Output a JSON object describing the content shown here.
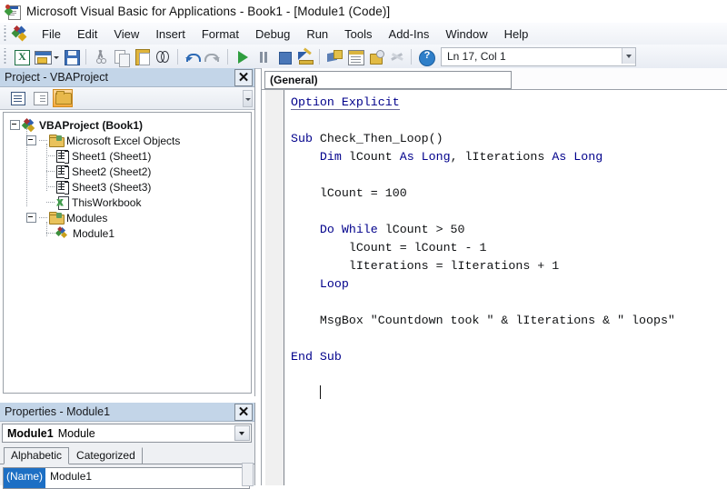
{
  "window": {
    "title": "Microsoft Visual Basic for Applications - Book1 - [Module1 (Code)]",
    "app_icon": "vba-document-icon"
  },
  "menubar": {
    "logo_icon": "vba-logo-icon",
    "items": [
      {
        "label": "File",
        "accel": "F"
      },
      {
        "label": "Edit",
        "accel": "E"
      },
      {
        "label": "View",
        "accel": "V"
      },
      {
        "label": "Insert",
        "accel": "I"
      },
      {
        "label": "Format",
        "accel": "o"
      },
      {
        "label": "Debug",
        "accel": "D"
      },
      {
        "label": "Run",
        "accel": "R"
      },
      {
        "label": "Tools",
        "accel": "T"
      },
      {
        "label": "Add-Ins",
        "accel": "A"
      },
      {
        "label": "Window",
        "accel": "W"
      },
      {
        "label": "Help",
        "accel": "H"
      }
    ]
  },
  "toolbar": {
    "buttons": [
      {
        "name": "view-excel-button",
        "icon": "excel-icon",
        "tooltip": "View Microsoft Excel"
      },
      {
        "name": "insert-userform-button",
        "icon": "insert-object-icon",
        "tooltip": "Insert"
      },
      {
        "name": "save-button",
        "icon": "save-icon",
        "tooltip": "Save Book1"
      },
      {
        "name": "cut-button",
        "icon": "scissors-icon",
        "tooltip": "Cut"
      },
      {
        "name": "copy-button",
        "icon": "copy-icon",
        "tooltip": "Copy"
      },
      {
        "name": "paste-button",
        "icon": "clipboard-icon",
        "tooltip": "Paste"
      },
      {
        "name": "find-button",
        "icon": "binoculars-icon",
        "tooltip": "Find"
      },
      {
        "name": "undo-button",
        "icon": "undo-arrow-icon",
        "tooltip": "Undo"
      },
      {
        "name": "redo-button",
        "icon": "redo-arrow-icon",
        "tooltip": "Redo"
      },
      {
        "name": "run-button",
        "icon": "play-triangle-icon",
        "tooltip": "Run Sub/UserForm"
      },
      {
        "name": "break-button",
        "icon": "pause-bars-icon",
        "tooltip": "Break"
      },
      {
        "name": "reset-button",
        "icon": "stop-square-icon",
        "tooltip": "Reset"
      },
      {
        "name": "design-mode-button",
        "icon": "design-mode-icon",
        "tooltip": "Design Mode"
      },
      {
        "name": "project-explorer-button",
        "icon": "project-explorer-icon",
        "tooltip": "Project Explorer"
      },
      {
        "name": "properties-window-button",
        "icon": "properties-window-icon",
        "tooltip": "Properties Window"
      },
      {
        "name": "object-browser-button",
        "icon": "object-browser-icon",
        "tooltip": "Object Browser"
      },
      {
        "name": "toolbox-button",
        "icon": "toolbox-wrench-icon",
        "tooltip": "Toolbox"
      },
      {
        "name": "help-button",
        "icon": "help-question-icon",
        "tooltip": "Microsoft Visual Basic for Applications Help"
      }
    ],
    "position_indicator": "Ln 17, Col 1"
  },
  "project_explorer": {
    "title": "Project - VBAProject",
    "close_label": "✕",
    "toolbar": [
      {
        "name": "view-code-button",
        "icon": "view-code-icon",
        "active": false
      },
      {
        "name": "view-object-button",
        "icon": "view-object-icon",
        "active": false
      },
      {
        "name": "toggle-folders-button",
        "icon": "folder-icon",
        "active": true
      }
    ],
    "tree": [
      {
        "label": "VBAProject (Book1)",
        "icon": "vba-project-icon",
        "level": 0,
        "bold": true,
        "expanded": true
      },
      {
        "label": "Microsoft Excel Objects",
        "icon": "folder-icon",
        "level": 1,
        "bold": false,
        "expanded": true
      },
      {
        "label": "Sheet1 (Sheet1)",
        "icon": "worksheet-icon",
        "level": 2,
        "bold": false
      },
      {
        "label": "Sheet2 (Sheet2)",
        "icon": "worksheet-icon",
        "level": 2,
        "bold": false
      },
      {
        "label": "Sheet3 (Sheet3)",
        "icon": "worksheet-icon",
        "level": 2,
        "bold": false
      },
      {
        "label": "ThisWorkbook",
        "icon": "workbook-icon",
        "level": 2,
        "bold": false
      },
      {
        "label": "Modules",
        "icon": "folder-icon",
        "level": 1,
        "bold": false,
        "expanded": true
      },
      {
        "label": "Module1",
        "icon": "module-icon",
        "level": 2,
        "bold": false
      }
    ]
  },
  "properties": {
    "title": "Properties - Module1",
    "close_label": "✕",
    "object_name": "Module1",
    "object_type": "Module",
    "tabs": [
      {
        "label": "Alphabetic",
        "active": true
      },
      {
        "label": "Categorized",
        "active": false
      }
    ],
    "rows": [
      {
        "name": "(Name)",
        "value": "Module1"
      }
    ]
  },
  "code_window": {
    "object_combo": "(General)",
    "procedure_combo": "",
    "lines": [
      {
        "indent": 0,
        "tokens": [
          {
            "t": "Option Explicit",
            "k": true,
            "u": true
          }
        ]
      },
      {
        "indent": 0,
        "tokens": []
      },
      {
        "indent": 0,
        "tokens": [
          {
            "t": "Sub",
            "k": true
          },
          {
            "t": " Check_Then_Loop()",
            "k": false
          }
        ]
      },
      {
        "indent": 1,
        "tokens": [
          {
            "t": "Dim",
            "k": true
          },
          {
            "t": " lCount ",
            "k": false
          },
          {
            "t": "As",
            "k": true
          },
          {
            "t": " ",
            "k": false
          },
          {
            "t": "Long",
            "k": true
          },
          {
            "t": ", lIterations ",
            "k": false
          },
          {
            "t": "As",
            "k": true
          },
          {
            "t": " ",
            "k": false
          },
          {
            "t": "Long",
            "k": true
          }
        ]
      },
      {
        "indent": 0,
        "tokens": []
      },
      {
        "indent": 1,
        "tokens": [
          {
            "t": "lCount = 100",
            "k": false
          }
        ]
      },
      {
        "indent": 0,
        "tokens": []
      },
      {
        "indent": 1,
        "tokens": [
          {
            "t": "Do While",
            "k": true
          },
          {
            "t": " lCount > 50",
            "k": false
          }
        ]
      },
      {
        "indent": 2,
        "tokens": [
          {
            "t": "lCount = lCount - 1",
            "k": false
          }
        ]
      },
      {
        "indent": 2,
        "tokens": [
          {
            "t": "lIterations = lIterations + 1",
            "k": false
          }
        ]
      },
      {
        "indent": 1,
        "tokens": [
          {
            "t": "Loop",
            "k": true
          }
        ]
      },
      {
        "indent": 0,
        "tokens": []
      },
      {
        "indent": 1,
        "tokens": [
          {
            "t": "MsgBox \"Countdown took \" & lIterations & \" loops\"",
            "k": false
          }
        ]
      },
      {
        "indent": 0,
        "tokens": []
      },
      {
        "indent": 0,
        "tokens": [
          {
            "t": "End Sub",
            "k": true
          }
        ]
      },
      {
        "indent": 0,
        "tokens": []
      },
      {
        "indent": 1,
        "tokens": [],
        "caret": true
      }
    ],
    "plain_text": "Option Explicit\n\nSub Check_Then_Loop()\n    Dim lCount As Long, lIterations As Long\n\n    lCount = 100\n\n    Do While lCount > 50\n        lCount = lCount - 1\n        lIterations = lIterations + 1\n    Loop\n\n    MsgBox \"Countdown took \" & lIterations & \" loops\"\n\nEnd Sub\n"
  },
  "colors": {
    "keyword": "#00008b",
    "panel_title_bg": "#c3d5e8",
    "toolbar_bg": "#eef1f6",
    "selected_prop": "#1d6fc4",
    "active_tool_bg": "#f5a93c"
  }
}
